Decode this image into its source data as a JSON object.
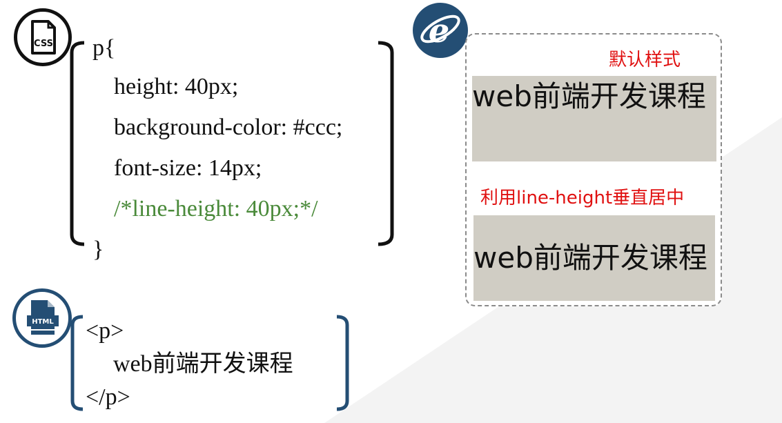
{
  "css_code": {
    "icon_label": "CSS",
    "open": "p{",
    "lines": [
      "height: 40px;",
      "background-color: #ccc;",
      "font-size: 14px;"
    ],
    "comment": "/*line-height: 40px;*/",
    "close": "}"
  },
  "html_code": {
    "icon_label": "HTML",
    "open_tag": "<p>",
    "content": "web前端开发课程",
    "close_tag": "</p>"
  },
  "demo": {
    "default_label": "默认样式",
    "default_text": "web前端开发课程",
    "centered_label": "利用line-height垂直居中",
    "centered_text": "web前端开发课程",
    "box_color": "#d0cdc4",
    "label_color": "#e01010"
  },
  "colors": {
    "accent": "#244e74",
    "comment": "#4a8a3a"
  }
}
